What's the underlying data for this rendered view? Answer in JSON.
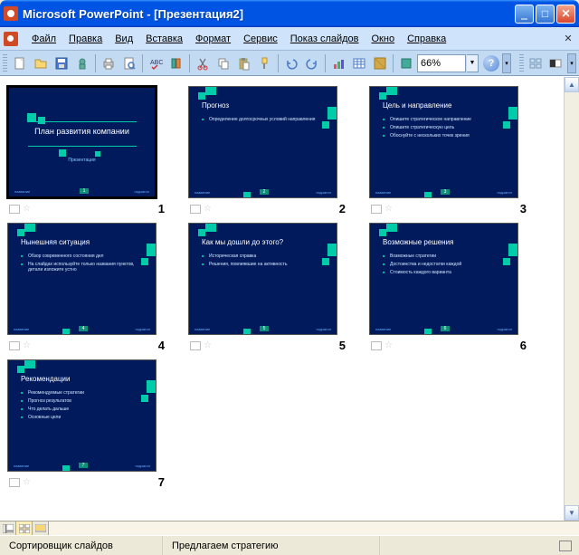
{
  "titlebar": {
    "title": "Microsoft PowerPoint - [Презентация2]"
  },
  "menus": {
    "file": "Файл",
    "edit": "Правка",
    "view": "Вид",
    "insert": "Вставка",
    "format": "Формат",
    "tools": "Сервис",
    "slideshow": "Показ слайдов",
    "window": "Окно",
    "help": "Справка"
  },
  "toolbar": {
    "zoom": "66%"
  },
  "slides": [
    {
      "num": "1",
      "title": "План развития компании",
      "sub": "Презентация",
      "type": "title"
    },
    {
      "num": "2",
      "title": "Прогноз",
      "bullets": [
        "Определение долгосрочных условий направления"
      ]
    },
    {
      "num": "3",
      "title": "Цель и направление",
      "bullets": [
        "Опишите стратегическое направление",
        "Опишите стратегическую цель",
        "Обоснуйте с нескольких точек зрения"
      ]
    },
    {
      "num": "4",
      "title": "Нынешняя ситуация",
      "bullets": [
        "Обзор современного состояния дел",
        "На слайдах используйте только названия пунктов, детали изложите устно"
      ]
    },
    {
      "num": "5",
      "title": "Как мы дошли до этого?",
      "bullets": [
        "Историческая справка",
        "Решения, повлиявшие на активность"
      ]
    },
    {
      "num": "6",
      "title": "Возможные решения",
      "bullets": [
        "Возможные стратегии",
        "Достоинства и недостатки каждой",
        "Стоимость каждого варианта"
      ]
    },
    {
      "num": "7",
      "title": "Рекомендации",
      "bullets": [
        "Рекомендуемые стратегии",
        "Прогноз результатов",
        "Что делать дальше",
        "Основные цели"
      ]
    }
  ],
  "statusbar": {
    "mode": "Сортировщик слайдов",
    "template": "Предлагаем стратегию"
  }
}
